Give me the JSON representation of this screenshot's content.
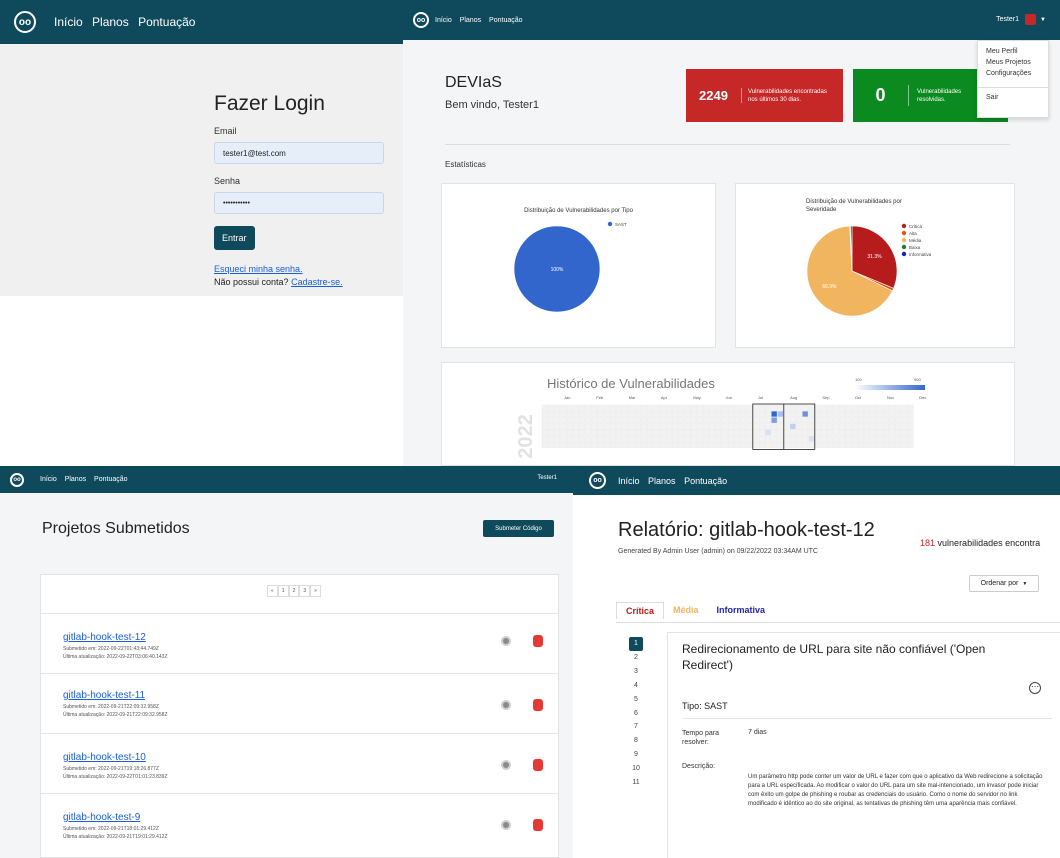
{
  "login": {
    "nav": {
      "logo": "oo",
      "links": [
        "Início",
        "Planos",
        "Pontuação"
      ]
    },
    "title": "Fazer Login",
    "email_label": "Email",
    "email_value": "tester1@test.com",
    "password_label": "Senha",
    "password_value": "•••••••••••",
    "submit": "Entrar",
    "forgot": "Esqueci minha senha.",
    "no_account": "Não possui conta?",
    "signup": "Cadastre-se."
  },
  "dashboard": {
    "nav": {
      "logo": "oo",
      "links": [
        "Início",
        "Planos",
        "Pontuação"
      ],
      "user": "Tester1"
    },
    "user_menu": [
      "Meu Perfil",
      "Meus Projetos",
      "Configurações",
      "Sair"
    ],
    "app_name": "DEVIaS",
    "welcome": "Bem vindo, Tester1",
    "stat_found": {
      "value": "2249",
      "label": "Vulnerabilidades encontradas nos últimos 30 dias.",
      "color": "#c62828"
    },
    "stat_resolved": {
      "value": "0",
      "label": "Vulnerabilidades resolvidas.",
      "color": "#0a8a1f"
    },
    "section": "Estatísticas",
    "heatmap_title": "Histórico de Vulnerabilidades",
    "heatmap_year": "2022",
    "heatmap_months": [
      "Jan",
      "Feb",
      "Mar",
      "Apr",
      "May",
      "Jun",
      "Jul",
      "Aug",
      "Sep",
      "Oct",
      "Nov",
      "Dec"
    ],
    "heatmap_legend": [
      "100",
      "900"
    ]
  },
  "chart_data": [
    {
      "type": "pie",
      "title": "Distribuição de Vulnerabilidades por Tipo",
      "categories": [
        "SAST"
      ],
      "values": [
        100
      ],
      "colors": [
        "#3366cc"
      ],
      "labels": [
        "100%"
      ],
      "legend": "top-right"
    },
    {
      "type": "pie",
      "title": "Distribuição de Vulnerabilidades por Severidade",
      "categories": [
        "Crítica",
        "Alta",
        "Média",
        "Baixa",
        "Informativa"
      ],
      "values": [
        31.3,
        1.0,
        66.9,
        0.3,
        0.5
      ],
      "colors": [
        "#b71c1c",
        "#e6550d",
        "#f2b55f",
        "#1b7f2a",
        "#1f1fb4"
      ],
      "labels": [
        "31.3%",
        "",
        "66.9%",
        "",
        ""
      ],
      "legend": "right"
    }
  ],
  "projects": {
    "nav": {
      "logo": "oo",
      "links": [
        "Início",
        "Planos",
        "Pontuação"
      ],
      "user": "Tester1"
    },
    "title": "Projetos Submetidos",
    "submit_button": "Submeter Código",
    "pagination": [
      "«",
      "1",
      "2",
      "3",
      "»"
    ],
    "items": [
      {
        "name": "gitlab-hook-test-12",
        "submitted": "Submetido em: 2022-09-22T01:43:44.749Z",
        "updated": "Última atualização: 2022-09-22T03:06:40.143Z"
      },
      {
        "name": "gitlab-hook-test-11",
        "submitted": "Submetido em: 2022-09-21T22:09:32.958Z",
        "updated": "Última atualização: 2022-09-21T22:09:32.958Z"
      },
      {
        "name": "gitlab-hook-test-10",
        "submitted": "Submetido em: 2022-09-21T19:18:26.877Z",
        "updated": "Última atualização: 2022-09-22T01:01:23.839Z"
      },
      {
        "name": "gitlab-hook-test-9",
        "submitted": "Submetido em: 2022-09-21T18:01:29.412Z",
        "updated": "Última atualização: 2022-09-21T19:01:29.412Z"
      }
    ]
  },
  "report": {
    "nav": {
      "logo": "oo",
      "links": [
        "Início",
        "Planos",
        "Pontuação"
      ]
    },
    "title": "Relatório: gitlab-hook-test-12",
    "vuln_count": "181",
    "vuln_text": "vulnerabilidades encontra",
    "generated": "Generated By Admin User (admin) on 09/22/2022 03:34AM UTC",
    "sort": "Ordenar por",
    "tabs": [
      {
        "label": "Crítica",
        "color": "#b71c1c"
      },
      {
        "label": "Média",
        "color": "#f2b55f"
      },
      {
        "label": "Informativa",
        "color": "#1f1fb4"
      }
    ],
    "numbers": [
      "1",
      "2",
      "3",
      "4",
      "5",
      "6",
      "7",
      "8",
      "9",
      "10",
      "11"
    ],
    "vuln_title": "Redirecionamento de URL para site não confiável ('Open Redirect')",
    "type": "Tipo: SAST",
    "time_label": "Tempo para resolver:",
    "time_value": "7 dias",
    "desc_label": "Descrição:",
    "desc_text": "Um parâmetro http pode conter um valor de URL e fazer com que o aplicativo da Web redirecione a solicitação para a URL especificada. Ao modificar o valor do URL para um site mal-intencionado, um invasor pode iniciar com êxito um golpe de phishing e roubar as credenciais do usuário. Como o nome do servidor no link modificado é idêntico ao do site original, as tentativas de phishing têm uma aparência mais confiável."
  }
}
